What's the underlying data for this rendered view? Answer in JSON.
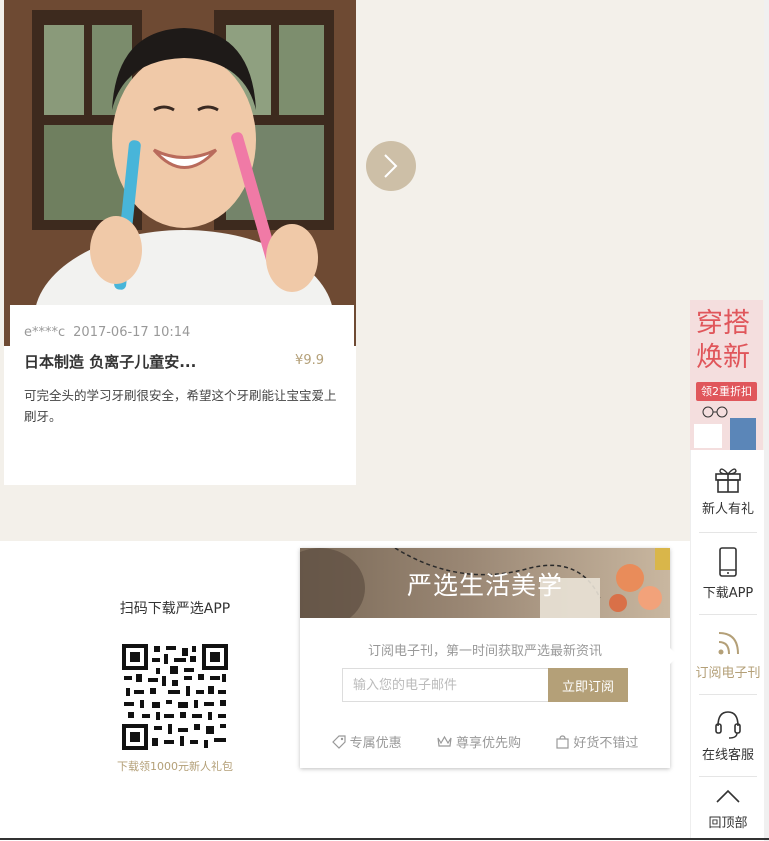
{
  "review": {
    "user": "e****c",
    "time": "2017-06-17 10:14",
    "product_title": "日本制造 负离子儿童安...",
    "price": "¥9.9",
    "text": "可完全头的学习牙刷很安全，希望这个牙刷能让宝宝爱上刷牙。"
  },
  "carousel": {
    "next_icon": "chevron-right-icon"
  },
  "app_download": {
    "title": "扫码下载严选APP",
    "subtitle": "下载领1000元新人礼包"
  },
  "subscribe": {
    "banner_title": "严选生活美学",
    "description": "订阅电子刊，第一时间获取严选最新资讯",
    "email_placeholder": "输入您的电子邮件",
    "email_value": "",
    "button_label": "立即订阅",
    "perks": [
      {
        "icon": "tag-icon",
        "label": "专属优惠"
      },
      {
        "icon": "crown-icon",
        "label": "尊享优先购"
      },
      {
        "icon": "shopping-bag-icon",
        "label": "好货不错过"
      }
    ]
  },
  "promo": {
    "line1": "穿搭",
    "line2": "焕新",
    "badge": "领2重折扣"
  },
  "sidebar": {
    "items": [
      {
        "icon": "gift-icon",
        "label": "新人有礼"
      },
      {
        "icon": "phone-icon",
        "label": "下载APP"
      },
      {
        "icon": "rss-icon",
        "label": "订阅电子刊"
      },
      {
        "icon": "headset-icon",
        "label": "在线客服"
      },
      {
        "icon": "chevron-up-icon",
        "label": "回顶部"
      }
    ]
  },
  "colors": {
    "accent": "#b4a078",
    "band_bg": "#f3f0ea",
    "promo_red": "#e0565b"
  }
}
